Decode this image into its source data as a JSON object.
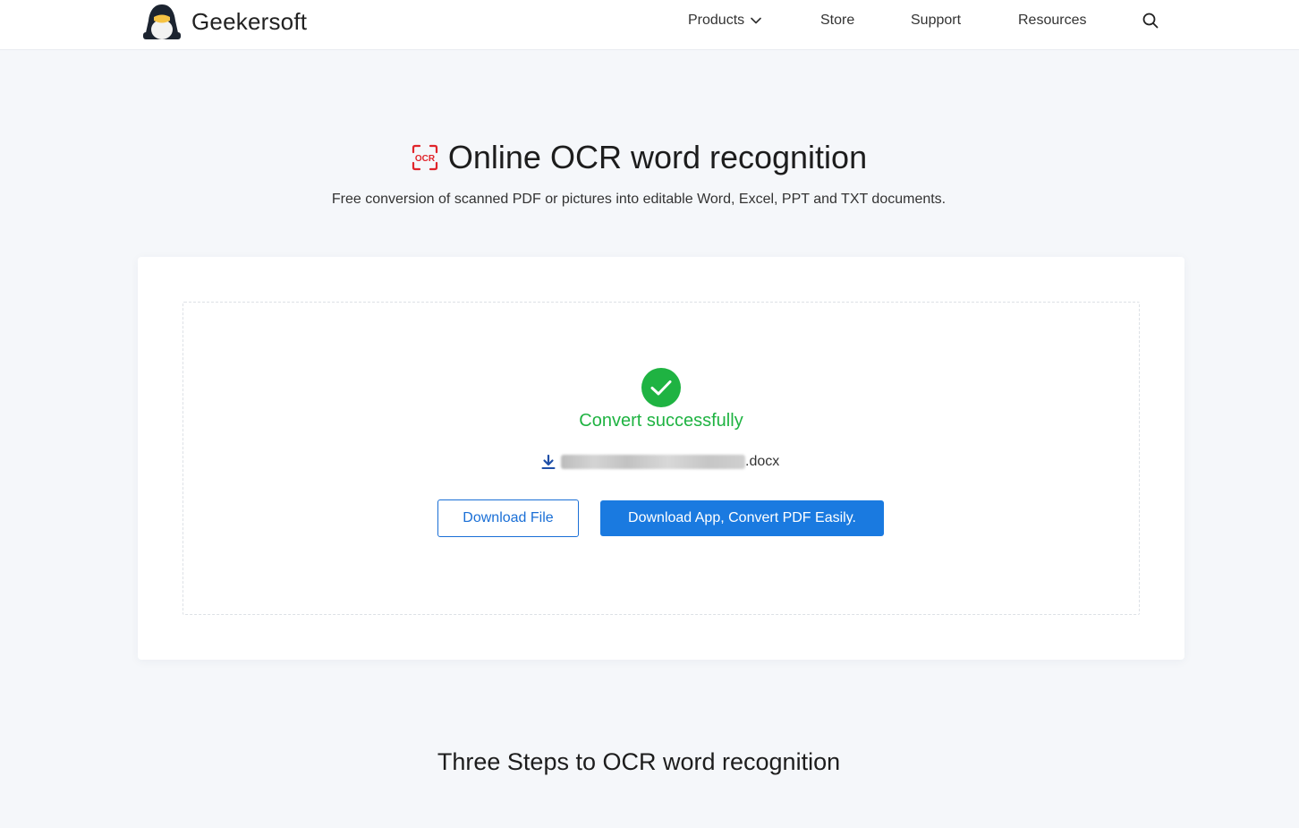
{
  "header": {
    "brand": "Geekersoft",
    "nav": {
      "products": "Products",
      "store": "Store",
      "support": "Support",
      "resources": "Resources"
    }
  },
  "hero": {
    "title": "Online OCR word recognition",
    "subtitle": "Free conversion of scanned PDF or pictures into editable Word, Excel, PPT and TXT documents.",
    "icon_text": "OCR"
  },
  "result": {
    "status": "Convert successfully",
    "file_extension": ".docx",
    "download_file_label": "Download File",
    "download_app_label": "Download App, Convert PDF Easily."
  },
  "steps": {
    "title": "Three Steps to OCR word recognition"
  },
  "colors": {
    "accent": "#1a7ae0",
    "success": "#1fb342",
    "ocr_icon": "#e0252b"
  }
}
